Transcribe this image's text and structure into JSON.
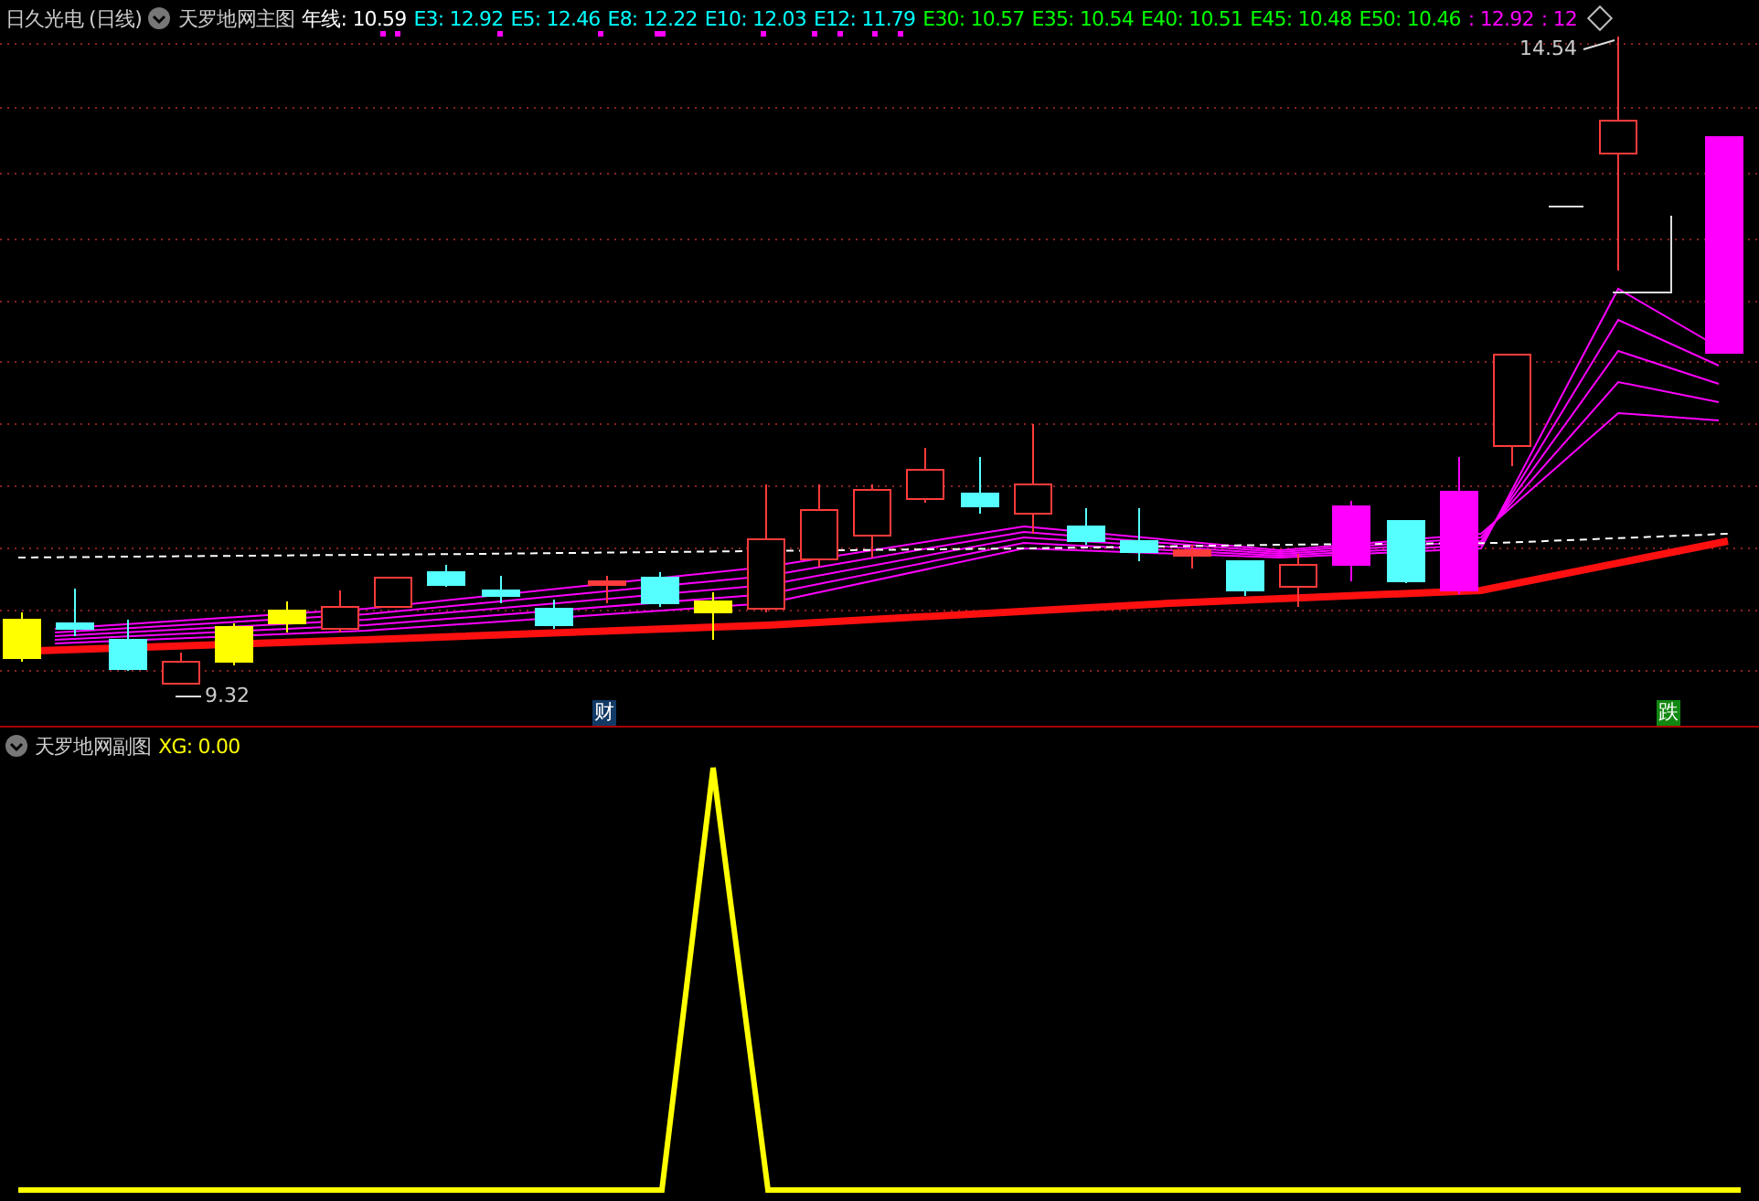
{
  "main_panel": {
    "stock": "日久光电 (日线)",
    "indicator": "天罗地网主图",
    "legend": [
      {
        "label": "年线: 10.59",
        "color": "#ffffff"
      },
      {
        "label": "E3: 12.92",
        "color": "#00ffff"
      },
      {
        "label": "E5: 12.46",
        "color": "#00ffff"
      },
      {
        "label": "E8: 12.22",
        "color": "#00ffff"
      },
      {
        "label": "E10: 12.03",
        "color": "#00ffff"
      },
      {
        "label": "E12: 11.79",
        "color": "#00ffff"
      },
      {
        "label": "E30: 10.57",
        "color": "#00ff00"
      },
      {
        "label": "E35: 10.54",
        "color": "#00ff00"
      },
      {
        "label": "E40: 10.51",
        "color": "#00ff00"
      },
      {
        "label": "E45: 10.48",
        "color": "#00ff00"
      },
      {
        "label": "E50: 10.46",
        "color": "#00ff00"
      },
      {
        "label": ": 12.92",
        "color": "#ff00ff"
      },
      {
        "label": ": 12",
        "color": "#ff00ff"
      }
    ],
    "high_label": "14.54",
    "low_label": "9.32",
    "markers": [
      {
        "text": "财",
        "kind": "finance"
      },
      {
        "text": "跌",
        "kind": "fall"
      }
    ]
  },
  "sub_panel": {
    "indicator": "天罗地网副图",
    "legend": [
      {
        "label": "XG: 0.00",
        "color": "#ffff00"
      }
    ]
  }
}
